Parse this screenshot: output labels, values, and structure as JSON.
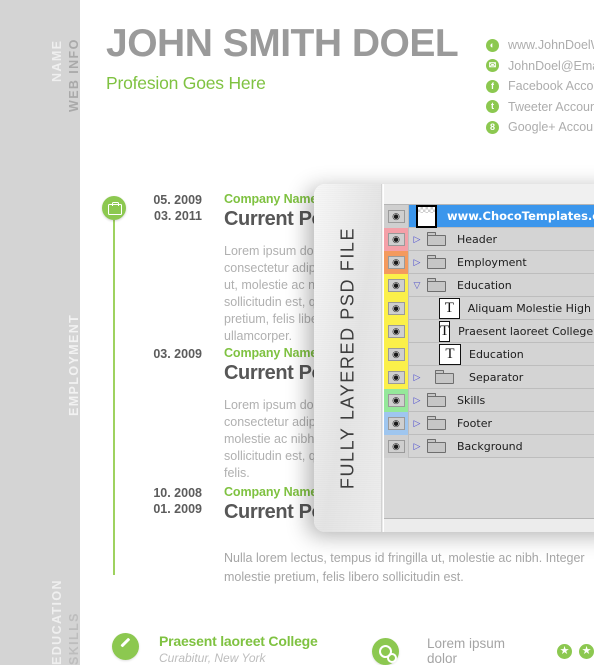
{
  "sidebar": {
    "labels": [
      {
        "id": "name",
        "text": "NAME"
      },
      {
        "id": "web-info",
        "text": "WEB INFO"
      },
      {
        "id": "employment",
        "text": "EMPLOYMENT"
      },
      {
        "id": "education",
        "text": "EDUCATION"
      },
      {
        "id": "skills",
        "text": "SKILLS"
      }
    ]
  },
  "header": {
    "name": "JOHN SMITH DOEL",
    "profession": "Profesion Goes Here",
    "name_color": "#9a9a9a",
    "accent_color": "#7fc241"
  },
  "web_info": [
    {
      "icon": "web-icon",
      "glyph": "◐",
      "text": "www.JohnDoelWebsite.com"
    },
    {
      "icon": "email-icon",
      "glyph": "✉",
      "text": "JohnDoel@Email.com"
    },
    {
      "icon": "facebook-icon",
      "glyph": "f",
      "text": "Facebook Account"
    },
    {
      "icon": "twitter-icon",
      "glyph": "t",
      "text": "Tweeter Account"
    },
    {
      "icon": "googleplus-icon",
      "glyph": "8",
      "text": "Google+ Account"
    }
  ],
  "employment": {
    "jobs": [
      {
        "date_from": "05. 2009",
        "date_to": "03. 2011",
        "company": "Company Name",
        "role": "Current Position",
        "desc": "Lorem ipsum dolor sit amet, consectetur adipiscing elit, id fringilla ut, molestie ac nibh. Integer euismod sollicitudin est, quis molestie pretium, felis libero nisl convallis ullamcorper."
      },
      {
        "date_from": "03. 2009",
        "date_to": "",
        "company": "Company Name",
        "role": "Current Position",
        "desc": "Lorem ipsum dolor sit amet, consectetur adipiscing id fringilla ut, molestie ac nibh. Integer euismod sollicitudin est, quis molestie pretium felis."
      },
      {
        "date_from": "10. 2008",
        "date_to": "01. 2009",
        "company": "Company Name",
        "role": "Current Position",
        "desc": ""
      }
    ],
    "footer_paragraph": "Nulla lorem lectus, tempus id fringilla ut, molestie ac nibh. Integer molestie pretium, felis libero sollicitudin est."
  },
  "bottom": {
    "education": {
      "icon": "pencil-icon",
      "title": "Praesent laoreet College",
      "subtitle": "Curabitur, New York"
    },
    "skills": {
      "icon": "gear-icon",
      "title": "Lorem ipsum dolor",
      "rating_glyph": "★",
      "rating_count": 2
    }
  },
  "psd_overlay": {
    "vertical_label": "FULLY LAYERED PSD FILE",
    "selected_color": "#3b96ec",
    "layers": [
      {
        "name": "www.ChocoTemplates.com",
        "thumb": "image",
        "swatch": "#cfcfcf",
        "selected": true,
        "expandable": false,
        "expanded": false,
        "indent": 0
      },
      {
        "name": "Header",
        "thumb": "folder",
        "swatch": "#f4a0a8",
        "selected": false,
        "expandable": true,
        "expanded": false,
        "indent": 0
      },
      {
        "name": "Employment",
        "thumb": "folder",
        "swatch": "#f49a5e",
        "selected": false,
        "expandable": true,
        "expanded": false,
        "indent": 0
      },
      {
        "name": "Education",
        "thumb": "folder",
        "swatch": "#fbf04a",
        "selected": false,
        "expandable": true,
        "expanded": true,
        "indent": 0
      },
      {
        "name": "Aliquam Molestie High Scool",
        "thumb": "text",
        "swatch": "#fbf04a",
        "selected": false,
        "expandable": false,
        "expanded": false,
        "indent": 1
      },
      {
        "name": "Praesent laoreet College Curabitur",
        "thumb": "text",
        "swatch": "#fbf04a",
        "selected": false,
        "expandable": false,
        "expanded": false,
        "indent": 1
      },
      {
        "name": "Education",
        "thumb": "text",
        "swatch": "#fbf04a",
        "selected": false,
        "expandable": false,
        "expanded": false,
        "indent": 1
      },
      {
        "name": "Separator",
        "thumb": "folder",
        "swatch": "#fbf04a",
        "selected": false,
        "expandable": true,
        "expanded": false,
        "indent": 1
      },
      {
        "name": "Skills",
        "thumb": "folder",
        "swatch": "#95e89a",
        "selected": false,
        "expandable": true,
        "expanded": false,
        "indent": 0
      },
      {
        "name": "Footer",
        "thumb": "folder",
        "swatch": "#9fc6ef",
        "selected": false,
        "expandable": true,
        "expanded": false,
        "indent": 0
      },
      {
        "name": "Background",
        "thumb": "folder",
        "swatch": "#cfcfcf",
        "selected": false,
        "expandable": true,
        "expanded": false,
        "indent": 0
      }
    ]
  }
}
